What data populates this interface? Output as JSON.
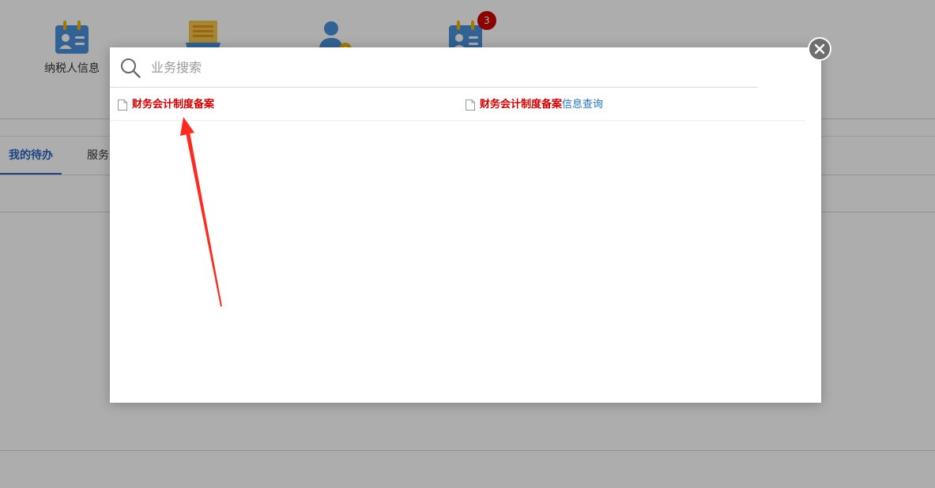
{
  "quick_menu": {
    "items": [
      {
        "label": "纳税人信息",
        "icon": "taxpayer-card-icon"
      },
      {
        "label": "",
        "icon": "document-tray-icon"
      },
      {
        "label": "",
        "icon": "user-settings-icon"
      },
      {
        "label": "",
        "icon": "notice-card-icon",
        "badge": "3"
      }
    ]
  },
  "tabs": [
    {
      "label": "我的待办",
      "active": true
    },
    {
      "label": "服务",
      "active": false
    }
  ],
  "search": {
    "placeholder": "业务搜索",
    "value": ""
  },
  "results": [
    {
      "highlight": "财务会计制度备案",
      "rest": "",
      "icon": "document-icon"
    },
    {
      "highlight": "财务会计制度备案",
      "rest": "信息查询",
      "icon": "document-icon"
    }
  ],
  "colors": {
    "highlight": "#cc0000",
    "link": "#2a6fbb",
    "tab_active": "#2a64c0",
    "badge": "#cc0000",
    "annotation_arrow": "#ff2a1f"
  }
}
